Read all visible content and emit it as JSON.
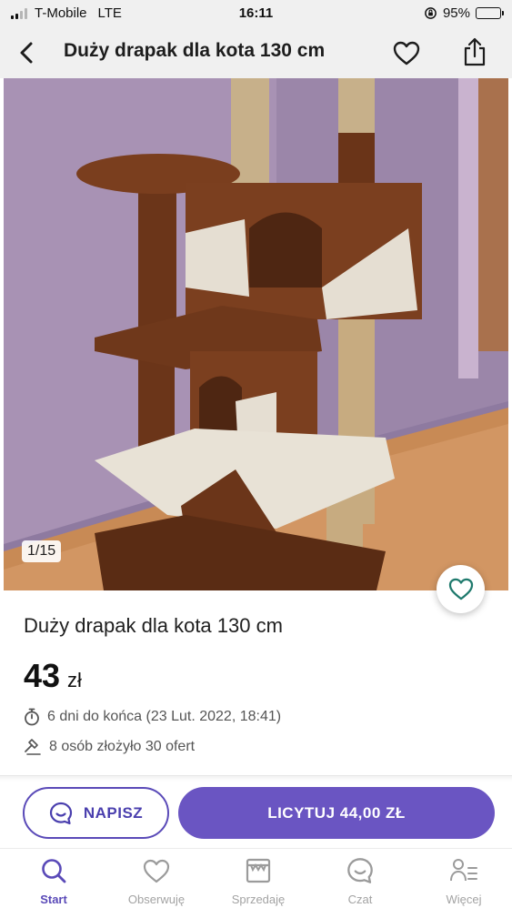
{
  "status_bar": {
    "carrier": "T-Mobile",
    "network": "LTE",
    "time": "16:11",
    "battery": "95%",
    "battery_level": 0.95
  },
  "header": {
    "title": "Duży drapak dla kota 130 cm"
  },
  "photo": {
    "counter": "1/15"
  },
  "listing": {
    "title": "Duży drapak dla kota 130 cm",
    "price_value": "43",
    "price_currency": "zł",
    "time_left": "6 dni do końca (23 Lut. 2022, 18:41)",
    "bids": "8 osób złożyło 30 ofert"
  },
  "actions": {
    "message_label": "NAPISZ",
    "bid_label": "LICYTUJ 44,00 ZŁ"
  },
  "tabbar": {
    "items": [
      {
        "label": "Start",
        "icon": "search-icon",
        "active": true
      },
      {
        "label": "Obserwuję",
        "icon": "heart-icon",
        "active": false
      },
      {
        "label": "Sprzedaję",
        "icon": "store-icon",
        "active": false
      },
      {
        "label": "Czat",
        "icon": "chat-icon",
        "active": false
      },
      {
        "label": "Więcej",
        "icon": "profile-menu-icon",
        "active": false
      }
    ]
  },
  "colors": {
    "accent": "#6a55c2",
    "accent_dark": "#4a3fae",
    "heart_teal": "#1f7a6d",
    "header_bg": "#f0f0f0"
  }
}
